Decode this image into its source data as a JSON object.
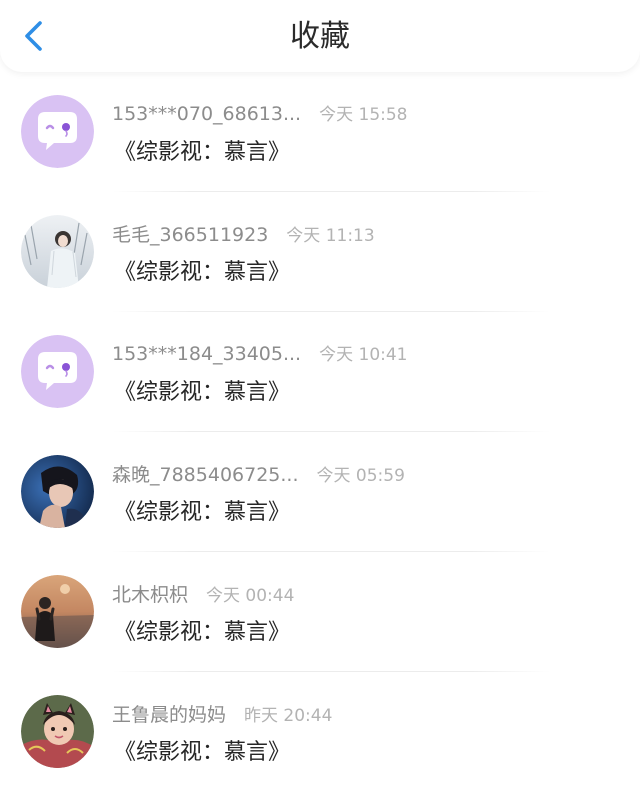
{
  "header": {
    "title": "收藏",
    "back_icon": "chevron-left-icon",
    "accent_color": "#2e8ee6"
  },
  "items": [
    {
      "user": "153***070_68613...",
      "time": "今天 15:58",
      "title": "《综影视：慕言》",
      "avatar": "default-chat-bubble"
    },
    {
      "user": "毛毛_366511923",
      "time": "今天 11:13",
      "title": "《综影视：慕言》",
      "avatar": "photo-girl-snow"
    },
    {
      "user": "153***184_33405...",
      "time": "今天 10:41",
      "title": "《综影视：慕言》",
      "avatar": "default-chat-bubble"
    },
    {
      "user": "森晚_7885406725...",
      "time": "今天 05:59",
      "title": "《综影视：慕言》",
      "avatar": "photo-boy-blue"
    },
    {
      "user": "北木枳枳",
      "time": "今天 00:44",
      "title": "《综影视：慕言》",
      "avatar": "photo-sunset-girl"
    },
    {
      "user": "王鲁晨的妈妈",
      "time": "昨天 20:44",
      "title": "《综影视：慕言》",
      "avatar": "photo-child-cat-ears"
    }
  ]
}
